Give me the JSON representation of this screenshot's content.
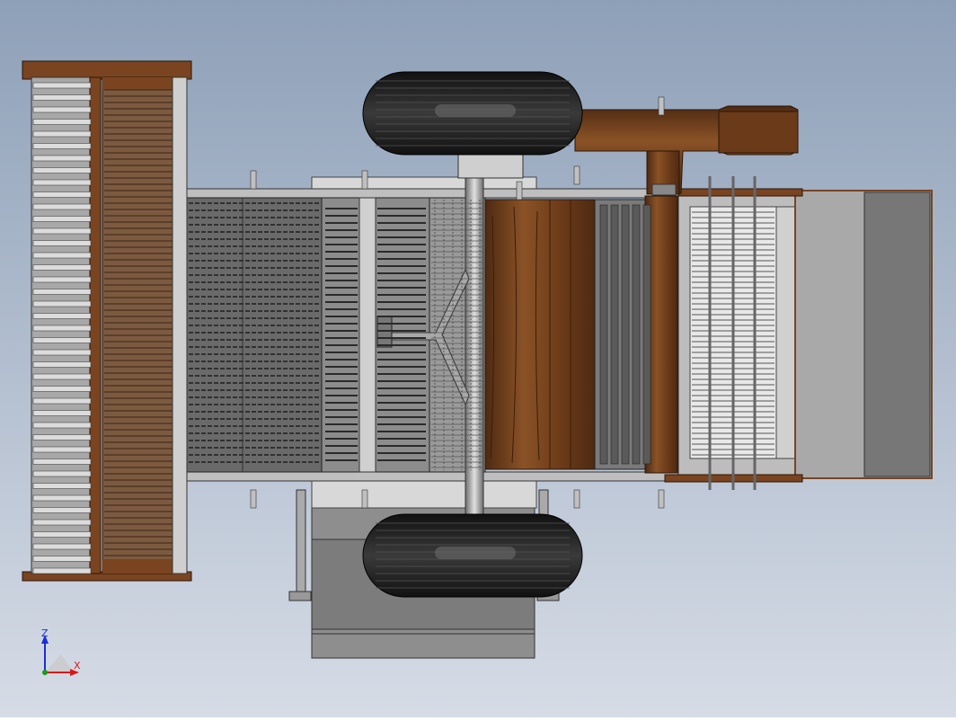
{
  "viewport": {
    "background_top": "#8ea0b8",
    "background_bottom": "#d6dce6"
  },
  "model": {
    "colors": {
      "wood": "#7a4420",
      "wood_dark": "#4e2a12",
      "steel_light": "#c8c8c8",
      "steel_mid": "#9a9a9a",
      "steel_dark": "#5e5e5e",
      "tire": "#1e1e1e",
      "panel_grey": "#8e8e8e"
    },
    "parts": [
      "header-reel",
      "feeder-grate",
      "threshing-section",
      "separator-cylinder",
      "sieve-section",
      "discharge-chute",
      "wheel-top",
      "wheel-bottom",
      "axle-frame",
      "auger-outlet",
      "engine-box"
    ]
  },
  "triad": {
    "x_label": "X",
    "z_label": "Z"
  }
}
